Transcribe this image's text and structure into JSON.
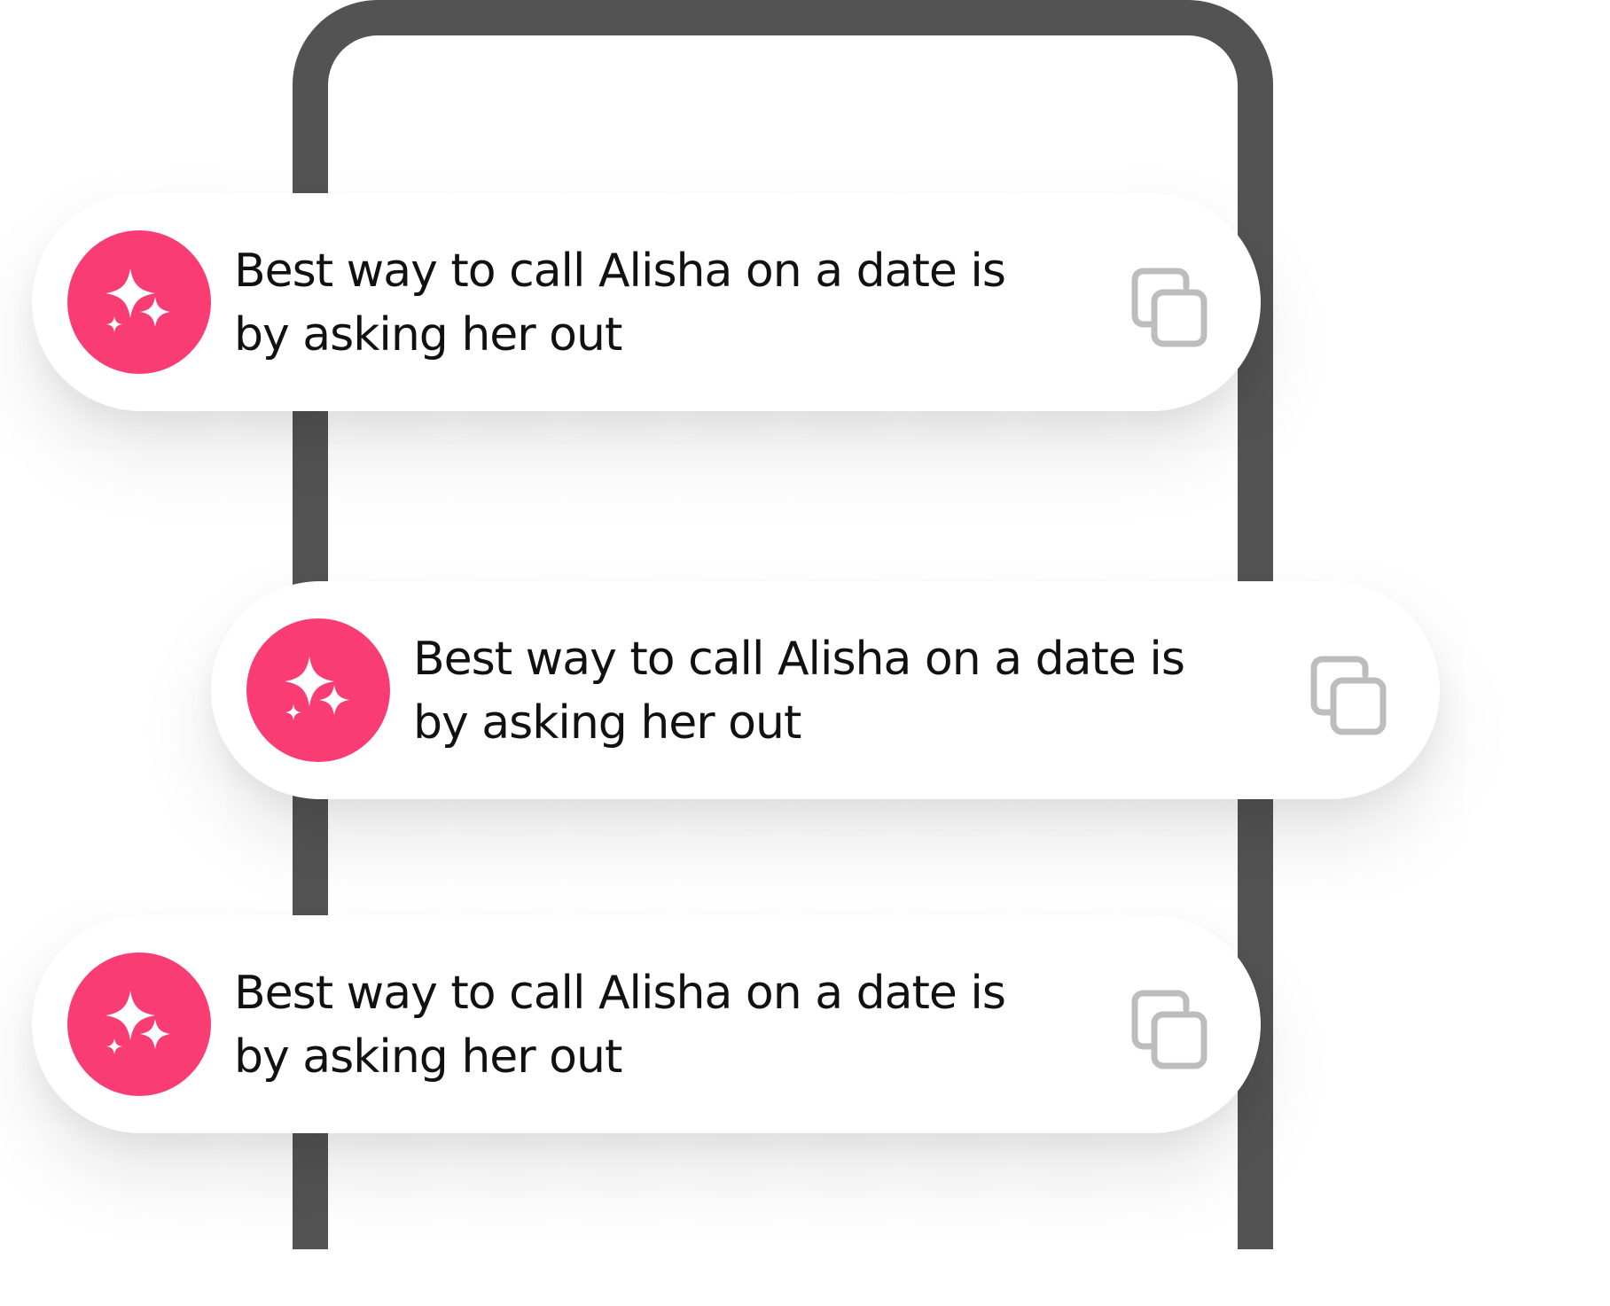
{
  "colors": {
    "frame": "#535353",
    "accent": "#f93d74",
    "copy_icon": "#bdbdbd",
    "text": "#111111"
  },
  "messages": [
    {
      "text": "Best way to call Alisha on a date is by asking her out",
      "avatar_icon": "sparkles-icon",
      "action_icon": "copy-icon"
    },
    {
      "text": "Best way to call Alisha on a date is by asking her out",
      "avatar_icon": "sparkles-icon",
      "action_icon": "copy-icon"
    },
    {
      "text": "Best way to call Alisha on a date is by asking her out",
      "avatar_icon": "sparkles-icon",
      "action_icon": "copy-icon"
    }
  ]
}
